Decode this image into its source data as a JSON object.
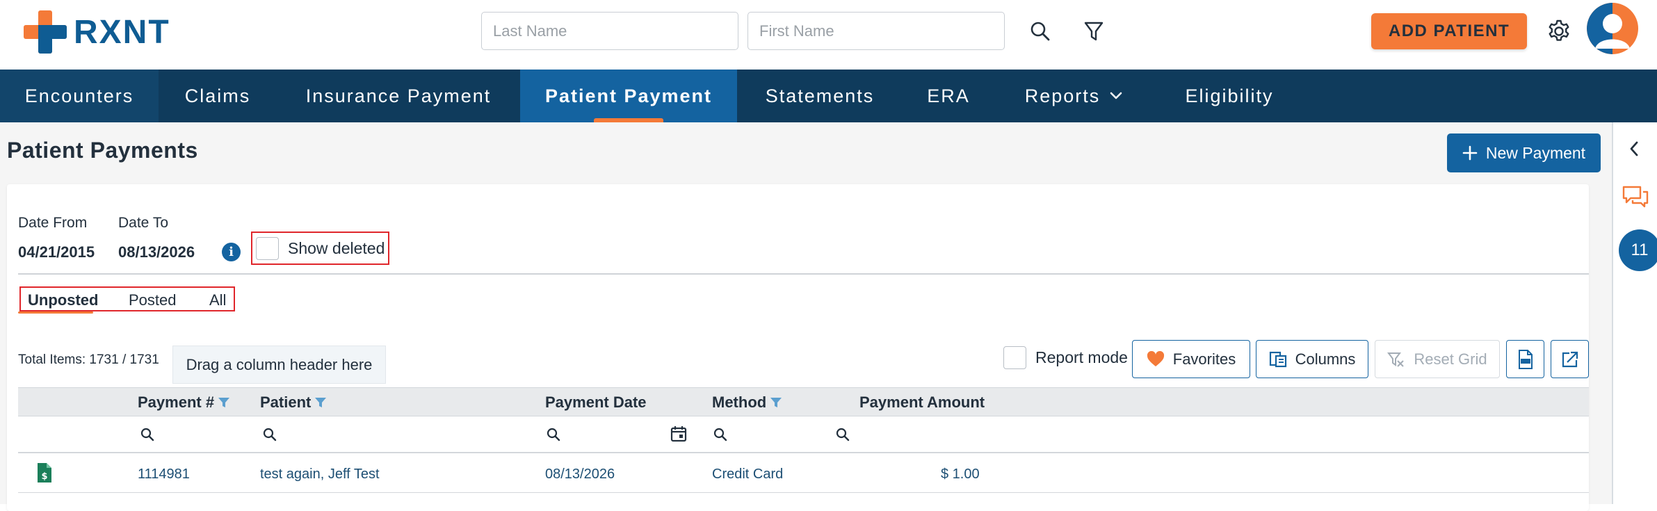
{
  "header": {
    "brand": "RXNT",
    "last_name_placeholder": "Last Name",
    "first_name_placeholder": "First Name",
    "add_patient_label": "ADD PATIENT",
    "search_icon": "search-icon",
    "filter_icon": "filter-icon",
    "settings_icon": "gear-icon",
    "avatar_icon": "user-avatar-icon"
  },
  "nav": {
    "items": [
      {
        "label": "Encounters"
      },
      {
        "label": "Claims"
      },
      {
        "label": "Insurance Payment"
      },
      {
        "label": "Patient Payment"
      },
      {
        "label": "Statements"
      },
      {
        "label": "ERA"
      },
      {
        "label": "Reports"
      },
      {
        "label": "Eligibility"
      }
    ],
    "active": "Patient Payment"
  },
  "page": {
    "title": "Patient Payments",
    "new_payment_label": "New Payment"
  },
  "filters": {
    "date_from_label": "Date From",
    "date_from_value": "04/21/2015",
    "date_to_label": "Date To",
    "date_to_value": "08/13/2026",
    "show_deleted_label": "Show deleted"
  },
  "tabs": {
    "items": [
      "Unposted",
      "Posted",
      "All"
    ],
    "active": "Unposted"
  },
  "toolbar": {
    "total_items": "Total Items: 1731 / 1731",
    "drag_hint": "Drag a column header here",
    "report_mode_label": "Report mode",
    "favorites_label": "Favorites",
    "columns_label": "Columns",
    "reset_grid_label": "Reset Grid"
  },
  "grid": {
    "columns": [
      "Payment #",
      "Patient",
      "Payment Date",
      "Method",
      "Payment Amount"
    ],
    "rows": [
      {
        "payment_no": "1114981",
        "patient": "test again, Jeff Test",
        "payment_date": "08/13/2026",
        "method": "Credit Card",
        "amount": "$ 1.00"
      }
    ]
  },
  "right_rail": {
    "badge_count": "11"
  },
  "colors": {
    "brand_orange": "#f47a38",
    "brand_blue": "#0f5c93",
    "nav_bg": "#0f3b5c",
    "nav_active": "#1463a0",
    "highlight_red": "#e0262b"
  }
}
